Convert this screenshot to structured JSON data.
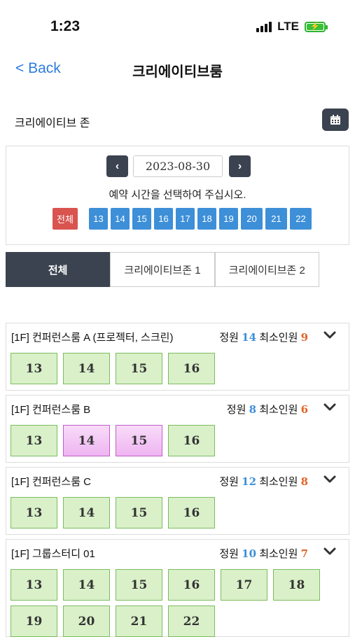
{
  "status": {
    "time": "1:23",
    "network": "LTE"
  },
  "nav": {
    "back_label": "< Back",
    "title": "크리에이티브룸"
  },
  "zone": {
    "label": "크리에이티브 존",
    "calendar_icon": "calendar-icon"
  },
  "date_picker": {
    "date": "2023-08-30",
    "prev_label": "‹",
    "next_label": "›"
  },
  "instruction": "예약 시간을 선택하여 주십시오.",
  "hour_filter": {
    "all_label": "전체",
    "hours": [
      "13",
      "14",
      "15",
      "16",
      "17",
      "18",
      "19",
      "20",
      "21",
      "22"
    ]
  },
  "tabs": [
    {
      "label": "전체",
      "active": true
    },
    {
      "label": "크리에이티브존 1",
      "active": false
    },
    {
      "label": "크리에이티브존 2",
      "active": false
    }
  ],
  "rooms": [
    {
      "name": "[1F] 컨퍼런스룸 A (프로젝터, 스크린)",
      "capacity_label": "정원",
      "capacity": "14",
      "min_label": "최소인원",
      "min": "9",
      "slots": [
        {
          "hour": "13",
          "reserved": false
        },
        {
          "hour": "14",
          "reserved": false
        },
        {
          "hour": "15",
          "reserved": false
        },
        {
          "hour": "16",
          "reserved": false
        }
      ]
    },
    {
      "name": "[1F] 컨퍼런스룸 B",
      "capacity_label": "정원",
      "capacity": "8",
      "min_label": "최소인원",
      "min": "6",
      "slots": [
        {
          "hour": "13",
          "reserved": false
        },
        {
          "hour": "14",
          "reserved": true
        },
        {
          "hour": "15",
          "reserved": true
        },
        {
          "hour": "16",
          "reserved": false
        }
      ]
    },
    {
      "name": "[1F] 컨퍼런스룸 C",
      "capacity_label": "정원",
      "capacity": "12",
      "min_label": "최소인원",
      "min": "8",
      "slots": [
        {
          "hour": "13",
          "reserved": false
        },
        {
          "hour": "14",
          "reserved": false
        },
        {
          "hour": "15",
          "reserved": false
        },
        {
          "hour": "16",
          "reserved": false
        }
      ]
    },
    {
      "name": "[1F] 그룹스터디 01",
      "capacity_label": "정원",
      "capacity": "10",
      "min_label": "최소인원",
      "min": "7",
      "slots": [
        {
          "hour": "13",
          "reserved": false
        },
        {
          "hour": "14",
          "reserved": false
        },
        {
          "hour": "15",
          "reserved": false
        },
        {
          "hour": "16",
          "reserved": false
        },
        {
          "hour": "17",
          "reserved": false
        },
        {
          "hour": "18",
          "reserved": false
        },
        {
          "hour": "19",
          "reserved": false
        },
        {
          "hour": "20",
          "reserved": false
        },
        {
          "hour": "21",
          "reserved": false
        },
        {
          "hour": "22",
          "reserved": false
        }
      ]
    }
  ],
  "colors": {
    "accent_blue": "#3d8fd8",
    "dark": "#3b4350",
    "all_red": "#d9534f",
    "available_green": "#d9f0c9",
    "reserved_pink": "#efb4f1",
    "min_orange": "#e0662a"
  }
}
